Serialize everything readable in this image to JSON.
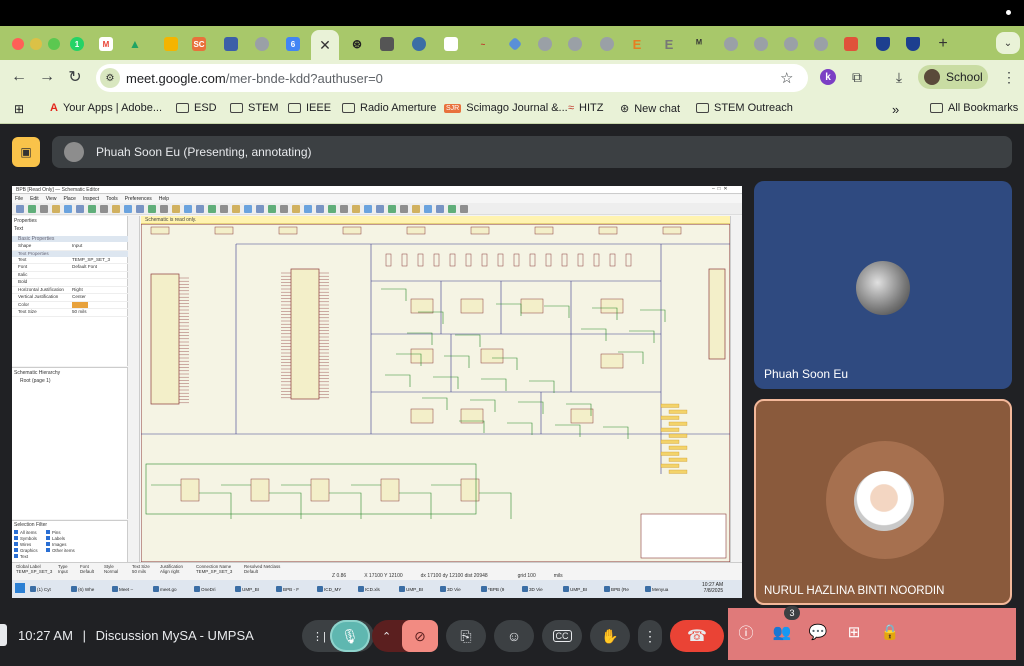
{
  "browser": {
    "url_domain": "meet.google.com",
    "url_path": "/mer-bnde-kdd?authuser=0",
    "profile_label": "School",
    "profile_badge": "k",
    "tabs": [
      {
        "icon": "whatsapp-icon",
        "label": "WA",
        "color": "#25D366"
      },
      {
        "icon": "gmail-icon",
        "label": "M",
        "color": "#EA4335"
      },
      {
        "icon": "drive-icon",
        "label": "▲",
        "color": "#1FA463"
      },
      {
        "icon": "slides-icon",
        "label": "",
        "color": "#F4B400"
      },
      {
        "icon": "sc-icon",
        "label": "SC",
        "color": "#E8713C"
      },
      {
        "icon": "calendar-icon",
        "label": "",
        "color": "#3C5FA8"
      },
      {
        "icon": "generic-tab-icon",
        "label": "",
        "color": "#9aa0a6"
      },
      {
        "icon": "calendar-icon",
        "label": "6",
        "color": "#4285F4"
      }
    ],
    "active_tab_symbol": "✕",
    "new_tab_symbol": "+",
    "bookmarks": [
      {
        "icon": "adobe-icon",
        "label": "Your Apps | Adobe..."
      },
      {
        "icon": "folder-icon",
        "label": "ESD"
      },
      {
        "icon": "folder-icon",
        "label": "STEM"
      },
      {
        "icon": "folder-icon",
        "label": "IEEE"
      },
      {
        "icon": "folder-icon",
        "label": "Radio Amerture"
      },
      {
        "icon": "sjr-icon",
        "label": "Scimago Journal &..."
      },
      {
        "icon": "hitz-icon",
        "label": "HITZ"
      },
      {
        "icon": "chatgpt-icon",
        "label": "New chat"
      },
      {
        "icon": "folder-icon",
        "label": "STEM Outreach"
      }
    ],
    "overflow_symbol": "»",
    "all_bookmarks": "All Bookmarks"
  },
  "meet": {
    "presenting_label": "Phuah Soon Eu (Presenting, annotating)",
    "participants": [
      {
        "name": "Phuah Soon Eu"
      },
      {
        "name": "NURUL HAZLINA BINTI NOORDIN"
      }
    ],
    "time": "10:27 AM",
    "meeting_name": "Discussion MySA - UMPSA",
    "separator": "|",
    "people_count": "3"
  },
  "kicad": {
    "window_title": "BPB [Read Only] — Schematic Editor",
    "menu": [
      "File",
      "Edit",
      "View",
      "Place",
      "Inspect",
      "Tools",
      "Preferences",
      "Help"
    ],
    "readonly_banner": "Schematic is read only.",
    "properties_title": "Properties",
    "properties_type": "Text",
    "basic_props_header": "Basic Properties",
    "text_props_header": "Text Properties",
    "properties": [
      {
        "key": "Shape",
        "value": "Input"
      },
      {
        "key": "Text",
        "value": "TEMP_SP_SET_3"
      },
      {
        "key": "Font",
        "value": "Default Font"
      },
      {
        "key": "Italic",
        "value": ""
      },
      {
        "key": "Bold",
        "value": ""
      },
      {
        "key": "Horizontal Justification",
        "value": "Right"
      },
      {
        "key": "Vertical Justification",
        "value": "Center"
      },
      {
        "key": "Color",
        "value": ""
      },
      {
        "key": "Text Size",
        "value": "50 mils"
      }
    ],
    "hierarchy_title": "Schematic Hierarchy",
    "hierarchy_root": "Root (page 1)",
    "selection_filter_title": "Selection Filter",
    "selection_filter": [
      "All items",
      "Symbols",
      "Wires",
      "Graphics",
      "Text",
      "Pins",
      "Labels",
      "Images",
      "Other items"
    ],
    "status_headers": [
      "Global Label",
      "Type",
      "Font",
      "Style",
      "Text Size",
      "Justification",
      "Connection Name",
      "Resolved Netclass"
    ],
    "status_values": [
      "TEMP_SP_SET_3",
      "Input",
      "Default",
      "Normal",
      "50 mils",
      "Align right",
      "TEMP_SP_SET_3",
      "Default"
    ],
    "coords": [
      "Z 0.86",
      "X 17100 Y 12100",
      "dx 17100 dy 12100 dist 20948",
      "grid 100",
      "mils"
    ],
    "taskbar_time": "10:27 AM",
    "taskbar_date": "7/8/2025",
    "taskbar_items": [
      "(1) Cyt",
      "(6) Whe",
      "Meet –",
      "meet.go",
      "OneDri",
      "UMP_BI",
      "BPB - F",
      "ICD_MY",
      "ICD.xls",
      "UMP_BI",
      "3D Vie",
      "*BPB (9",
      "3D Vie",
      "UMP_BI",
      "BPB (Re",
      "Menyua"
    ]
  },
  "colors": {
    "chrome_tab_strip": "#a8c86a",
    "chrome_toolbar": "#e9f2d7",
    "meet_bg": "#202124",
    "end_call": "#ea4335",
    "mic_active": "#5fb7b0",
    "cam_off": "#f28b82",
    "side_panel": "#e07a7a",
    "tile_participant1": "#2f4a80",
    "tile_participant2": "#8a5a3c"
  }
}
